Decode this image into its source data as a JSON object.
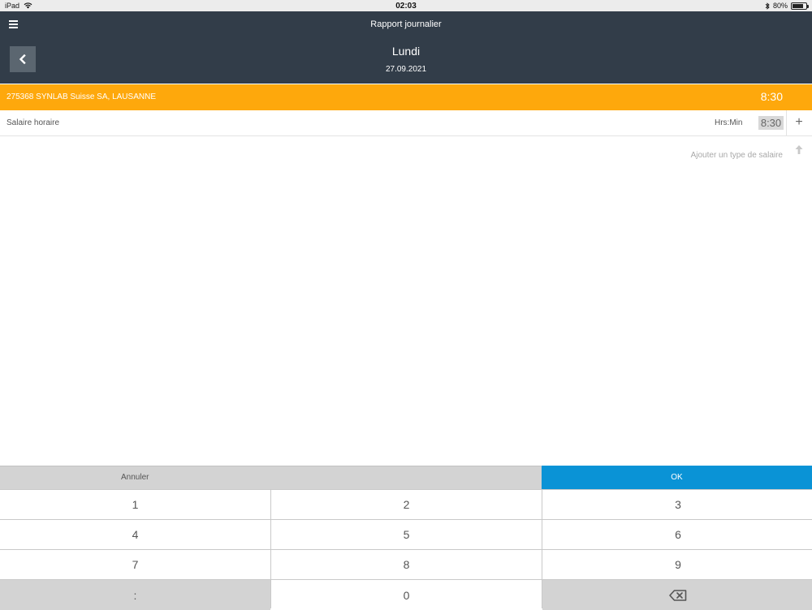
{
  "status_bar": {
    "device": "iPad",
    "time": "02:03",
    "battery": "80%",
    "battery_level": 0.8
  },
  "header": {
    "title": "Rapport journalier",
    "day": "Lundi",
    "date": "27.09.2021"
  },
  "client": {
    "name": "275368 SYNLAB Suisse SA, LAUSANNE",
    "total": "8:30",
    "color": "#fea80c"
  },
  "wage_entry": {
    "label": "Salaire horaire",
    "unit": "Hrs:Min",
    "value": "8:30",
    "add_symbol": "+"
  },
  "add_wage_type": "Ajouter un type de salaire",
  "keypad": {
    "cancel_label": "Annuler",
    "ok_label": "OK",
    "ok_color": "#0a93d6",
    "keys": [
      "1",
      "2",
      "3",
      "4",
      "5",
      "6",
      "7",
      "8",
      "9",
      ":",
      "0"
    ]
  },
  "colors": {
    "header_bg": "#323d49",
    "back_button_bg": "#5b6670"
  }
}
